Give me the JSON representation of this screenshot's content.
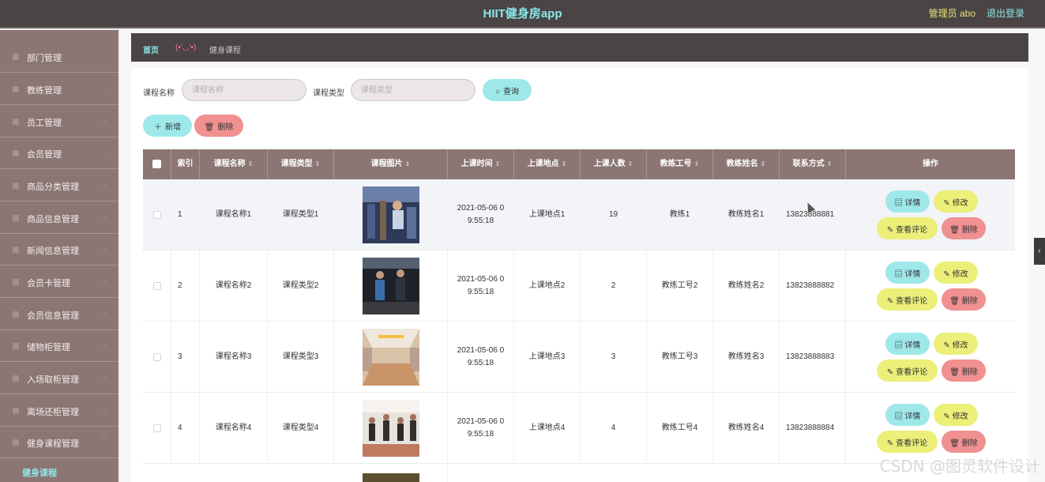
{
  "app": {
    "title": "HIIT健身房app",
    "user": "管理员 abo",
    "logout": "退出登录"
  },
  "sidebar": {
    "items": [
      {
        "label": "部门管理"
      },
      {
        "label": "教练管理"
      },
      {
        "label": "员工管理"
      },
      {
        "label": "会员管理"
      },
      {
        "label": "商品分类管理"
      },
      {
        "label": "商品信息管理"
      },
      {
        "label": "新闻信息管理"
      },
      {
        "label": "会员卡管理"
      },
      {
        "label": "会员信息管理"
      },
      {
        "label": "储物柜管理"
      },
      {
        "label": "入场取柜管理"
      },
      {
        "label": "离场还柜管理"
      },
      {
        "label": "健身课程管理"
      }
    ],
    "active_sub": "健身课程"
  },
  "breadcrumb": {
    "home": "首页",
    "face": "(•'◡'•)",
    "current": "健身课程"
  },
  "search": {
    "name_label": "课程名称",
    "name_placeholder": "课程名称",
    "type_label": "课程类型",
    "type_placeholder": "课程类型",
    "query_button": "查询"
  },
  "actions": {
    "add": "新增",
    "delete": "删除"
  },
  "table": {
    "columns": [
      "索引",
      "课程名称",
      "课程类型",
      "课程图片",
      "上课时间",
      "上课地点",
      "上课人数",
      "教练工号",
      "教练姓名",
      "联系方式",
      "操作"
    ],
    "rows": [
      {
        "index": "1",
        "name": "课程名称1",
        "type": "课程类型1",
        "time_a": "2021-05-06 0",
        "time_b": "9:55:18",
        "place": "上课地点1",
        "count": "19",
        "coach_id": "教练1",
        "coach_name": "教练姓名1",
        "phone": "13823888881"
      },
      {
        "index": "2",
        "name": "课程名称2",
        "type": "课程类型2",
        "time_a": "2021-05-06 0",
        "time_b": "9:55:18",
        "place": "上课地点2",
        "count": "2",
        "coach_id": "教练工号2",
        "coach_name": "教练姓名2",
        "phone": "13823888882"
      },
      {
        "index": "3",
        "name": "课程名称3",
        "type": "课程类型3",
        "time_a": "2021-05-06 0",
        "time_b": "9:55:18",
        "place": "上课地点3",
        "count": "3",
        "coach_id": "教练工号3",
        "coach_name": "教练姓名3",
        "phone": "13823888883"
      },
      {
        "index": "4",
        "name": "课程名称4",
        "type": "课程类型4",
        "time_a": "2021-05-06 0",
        "time_b": "9:55:18",
        "place": "上课地点4",
        "count": "4",
        "coach_id": "教练工号4",
        "coach_name": "教练姓名4",
        "phone": "13823888884"
      }
    ],
    "row_buttons": {
      "detail": "详情",
      "edit": "修改",
      "comments": "查看评论",
      "delete": "删除"
    }
  },
  "watermark": "CSDN @图灵软件设计",
  "colors": {
    "header": "#4a4444",
    "sidebar": "#8b7673",
    "accent_cyan": "#9fe8ea",
    "accent_yellow": "#ecef78",
    "accent_red": "#f09090"
  }
}
